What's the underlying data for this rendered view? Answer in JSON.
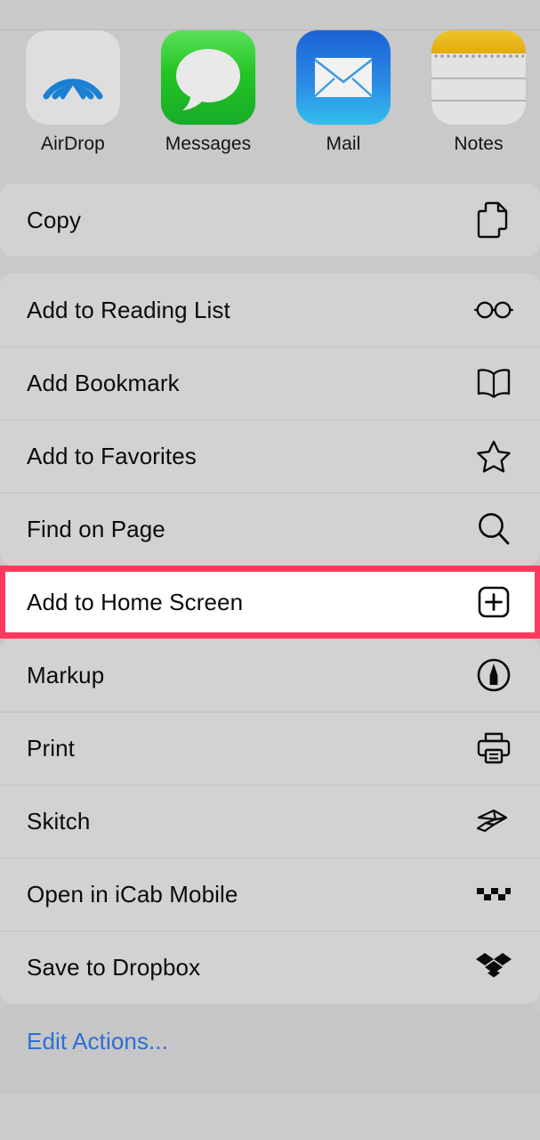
{
  "sheet": {
    "background_color": "#c9c9c9",
    "group_color": "#d2d2d2",
    "highlight_color": "#fd3a5e",
    "link_color": "#2b6fd6"
  },
  "apps": [
    {
      "label": "AirDrop",
      "icon": "airdrop-icon"
    },
    {
      "label": "Messages",
      "icon": "messages-icon"
    },
    {
      "label": "Mail",
      "icon": "mail-icon"
    },
    {
      "label": "Notes",
      "icon": "notes-icon"
    }
  ],
  "actions_group_1": [
    {
      "label": "Copy",
      "icon": "copy-icon"
    }
  ],
  "actions_group_2": [
    {
      "label": "Add to Reading List",
      "icon": "glasses-icon"
    },
    {
      "label": "Add Bookmark",
      "icon": "book-icon"
    },
    {
      "label": "Add to Favorites",
      "icon": "star-icon"
    },
    {
      "label": "Find on Page",
      "icon": "magnifier-icon"
    }
  ],
  "highlighted_action": {
    "label": "Add to Home Screen",
    "icon": "plus-square-icon"
  },
  "actions_group_3": [
    {
      "label": "Markup",
      "icon": "markup-pen-icon"
    },
    {
      "label": "Print",
      "icon": "printer-icon"
    },
    {
      "label": "Skitch",
      "icon": "skitch-icon"
    },
    {
      "label": "Open in iCab Mobile",
      "icon": "icab-taxi-icon"
    },
    {
      "label": "Save to Dropbox",
      "icon": "dropbox-icon"
    }
  ],
  "footer": {
    "edit_actions_label": "Edit Actions..."
  }
}
